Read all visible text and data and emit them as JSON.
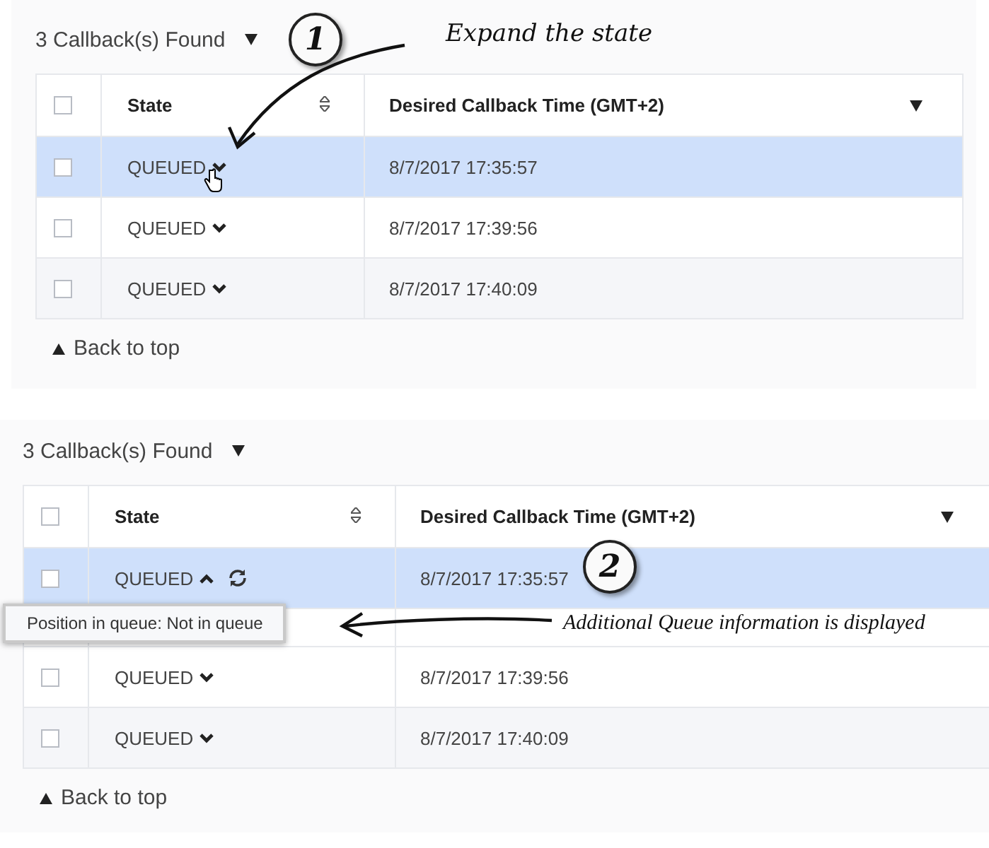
{
  "panels": [
    {
      "count_label": "3 Callback(s) Found",
      "header_checked": false,
      "columns": [
        {
          "label": "State",
          "sorted": false
        },
        {
          "label": "Desired Callback Time (GMT+2)",
          "sorted": true
        }
      ],
      "rows": [
        {
          "state": "QUEUED",
          "time": "8/7/2017 17:35:57",
          "checked": false,
          "selected": true,
          "expanded": false,
          "hovered": true
        },
        {
          "state": "QUEUED",
          "time": "8/7/2017 17:39:56",
          "checked": false,
          "selected": false,
          "expanded": false,
          "hovered": false
        },
        {
          "state": "QUEUED",
          "time": "8/7/2017 17:40:09",
          "checked": false,
          "selected": false,
          "expanded": false,
          "hovered": false
        }
      ],
      "back_link": "Back to top",
      "callout": {
        "number": "1",
        "note": "Expand the state"
      }
    },
    {
      "count_label": "3 Callback(s) Found",
      "header_checked": false,
      "columns": [
        {
          "label": "State",
          "sorted": false
        },
        {
          "label": "Desired Callback Time (GMT+2)",
          "sorted": true
        }
      ],
      "rows": [
        {
          "state": "QUEUED",
          "time": "8/7/2017 17:35:57",
          "checked": false,
          "selected": true,
          "expanded": true,
          "hovered": false,
          "detail": "Position in queue: Not in queue"
        },
        {
          "state": "QUEUED",
          "time": "8/7/2017 17:39:56",
          "checked": false,
          "selected": false,
          "expanded": false,
          "hovered": false
        },
        {
          "state": "QUEUED",
          "time": "8/7/2017 17:40:09",
          "checked": false,
          "selected": false,
          "expanded": false,
          "hovered": false
        }
      ],
      "back_link": "Back to top",
      "callout": {
        "number": "2",
        "note": "Additional Queue information is displayed"
      }
    }
  ]
}
